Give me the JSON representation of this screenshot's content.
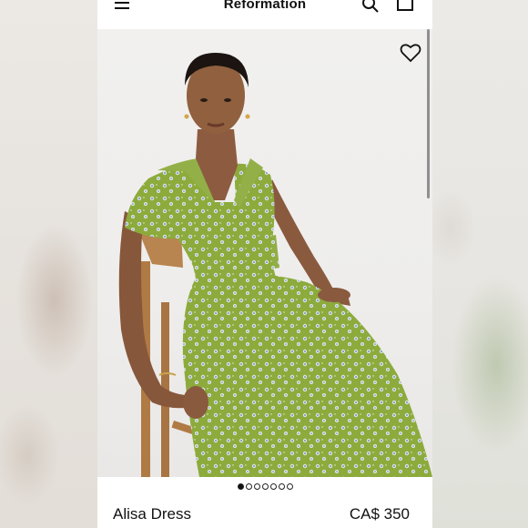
{
  "header": {
    "brand": "Reformation",
    "menu_icon": "hamburger-menu-icon",
    "search_icon": "search-icon",
    "bag_icon": "shopping-bag-icon"
  },
  "gallery": {
    "favorite_icon": "heart-icon",
    "image_count": 7,
    "active_index": 0
  },
  "product": {
    "name": "Alisa Dress",
    "price": "CA$ 350"
  },
  "colors": {
    "dress_green": "#8fae3e",
    "background": "#efeeec",
    "text": "#111111"
  }
}
